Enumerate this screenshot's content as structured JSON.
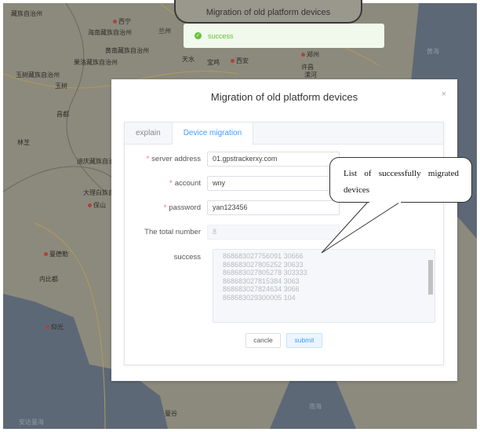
{
  "map": {
    "labels": [
      "藏族自治州",
      "西宁",
      "海南藏族自治州",
      "黄南藏族自治州",
      "果洛藏族自治州",
      "玉树藏族自治州",
      "玉树",
      "昌都",
      "林芝",
      "迪庆藏族自治州",
      "大理白族自治州",
      "保山",
      "曼德勒",
      "内比都",
      "仰光",
      "安达曼海",
      "兰州",
      "天水",
      "宝鸡",
      "西安",
      "郑州",
      "许昌",
      "漯河",
      "黄海",
      "曼谷",
      "南海"
    ]
  },
  "background_title": "Migration of old platform devices",
  "toast": {
    "message": "success"
  },
  "modal": {
    "title": "Migration of old platform devices",
    "close": "×",
    "tabs": [
      {
        "label": "explain"
      },
      {
        "label": "Device migration"
      }
    ],
    "form": {
      "server_address": {
        "label": "server address",
        "value": "01.gpstrackerxy.com"
      },
      "account": {
        "label": "account",
        "value": "wny"
      },
      "password": {
        "label": "password",
        "value": "yan123456"
      },
      "total": {
        "label": "The total number",
        "value": "8"
      },
      "success": {
        "label": "success",
        "lines": [
          "868683027756091  30666",
          "868683027805252  30633",
          "868683027805278  303333",
          "868683027815384  3063",
          "868683027824634  3066",
          "868683029300005  104"
        ]
      }
    },
    "required_mark": "*",
    "buttons": {
      "cancel": "cancle",
      "submit": "submit"
    }
  },
  "callout": {
    "text": "List of successfully migrated devices"
  }
}
